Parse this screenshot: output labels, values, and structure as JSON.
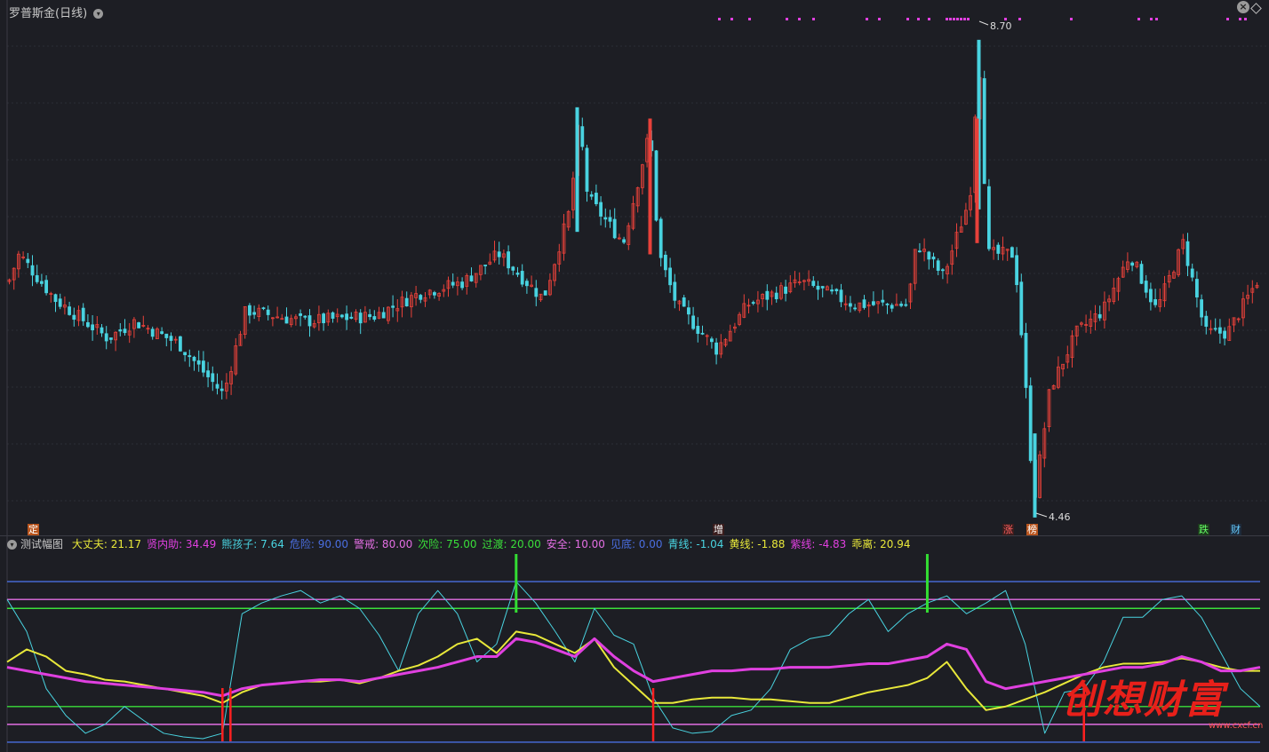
{
  "main_panel": {
    "title": "罗普斯金(日线)"
  },
  "indicator_panel": {
    "title": "测试幅图",
    "legend": [
      {
        "label": "大丈夫: 21.17",
        "color": "#e8e83a"
      },
      {
        "label": "贤内助: 34.49",
        "color": "#e040e0"
      },
      {
        "label": "熊孩子: 7.64",
        "color": "#49d3e0"
      },
      {
        "label": "危险: 90.00",
        "color": "#4a6ee0"
      },
      {
        "label": "警戒: 80.00",
        "color": "#e36fe3"
      },
      {
        "label": "次险: 75.00",
        "color": "#3ade3a"
      },
      {
        "label": "过渡: 20.00",
        "color": "#3ade3a"
      },
      {
        "label": "安全: 10.00",
        "color": "#e36fe3"
      },
      {
        "label": "见底: 0.00",
        "color": "#4a6ee0"
      },
      {
        "label": "青线: -1.04",
        "color": "#49d3e0"
      },
      {
        "label": "黄线: -1.88",
        "color": "#e8e83a"
      },
      {
        "label": "紫线: -4.83",
        "color": "#e040e0"
      },
      {
        "label": "乖离: 20.94",
        "color": "#e8e83a"
      }
    ]
  },
  "signals": [
    {
      "label": "定",
      "bg": "#b8541d",
      "color": "#ffffff"
    },
    {
      "label": "增",
      "bg": "#3a1d1d",
      "color": "#ffffff"
    },
    {
      "label": "涨",
      "bg": "#3a1d1d",
      "color": "#ff6060"
    },
    {
      "label": "榜",
      "bg": "#b8541d",
      "color": "#ffffff"
    },
    {
      "label": "跌",
      "bg": "#1d3a1d",
      "color": "#66ff66"
    },
    {
      "label": "财",
      "bg": "#1d2a3a",
      "color": "#66ccff"
    }
  ],
  "watermark": {
    "text": "创想财富",
    "url": "www.cxcf.cn"
  },
  "chart_data": [
    {
      "type": "candlestick",
      "title": "罗普斯金(日线)",
      "price_annotations": [
        {
          "label": "8.70",
          "value": 8.7
        },
        {
          "label": "4.46",
          "value": 4.46
        }
      ],
      "ylim": [
        4.4,
        8.9
      ],
      "colors": {
        "up": "#e8413a",
        "down": "#49d3e0"
      }
    },
    {
      "type": "line",
      "title": "测试幅图",
      "ylim": [
        -2,
        100
      ],
      "reference_lines": [
        {
          "name": "危险",
          "value": 90,
          "color": "#4a6ee0"
        },
        {
          "name": "警戒",
          "value": 80,
          "color": "#e36fe3"
        },
        {
          "name": "次险",
          "value": 75,
          "color": "#3ade3a"
        },
        {
          "name": "过渡",
          "value": 20,
          "color": "#3ade3a"
        },
        {
          "name": "安全",
          "value": 10,
          "color": "#e36fe3"
        },
        {
          "name": "见底",
          "value": 0,
          "color": "#4a6ee0"
        }
      ],
      "series": [
        {
          "name": "熊孩子",
          "color": "#49d3e0",
          "values": [
            80,
            62,
            30,
            15,
            5,
            10,
            20,
            12,
            5,
            3,
            2,
            5,
            72,
            78,
            82,
            85,
            78,
            82,
            75,
            60,
            40,
            72,
            85,
            72,
            45,
            55,
            90,
            78,
            62,
            45,
            75,
            60,
            55,
            25,
            8,
            5,
            6,
            15,
            18,
            30,
            52,
            58,
            60,
            72,
            80,
            62,
            72,
            78,
            82,
            72,
            78,
            85,
            55,
            5,
            28,
            30,
            45,
            70,
            70,
            80,
            82,
            70,
            50,
            30,
            20
          ]
        },
        {
          "name": "大丈夫",
          "color": "#e8e83a",
          "values": [
            45,
            52,
            48,
            40,
            38,
            35,
            34,
            32,
            30,
            28,
            26,
            22,
            28,
            32,
            33,
            34,
            34,
            35,
            33,
            36,
            40,
            43,
            48,
            55,
            58,
            50,
            62,
            60,
            55,
            50,
            58,
            42,
            32,
            22,
            22,
            24,
            25,
            25,
            24,
            24,
            23,
            22,
            22,
            25,
            28,
            30,
            32,
            36,
            45,
            30,
            18,
            20,
            24,
            28,
            33,
            38,
            42,
            44,
            44,
            45,
            47,
            45,
            42,
            40,
            40
          ]
        },
        {
          "name": "贤内助",
          "color": "#e040e0",
          "values": [
            42,
            40,
            38,
            36,
            34,
            33,
            32,
            31,
            30,
            29,
            28,
            26,
            30,
            32,
            33,
            34,
            35,
            35,
            34,
            36,
            38,
            40,
            42,
            45,
            48,
            48,
            58,
            56,
            52,
            48,
            58,
            48,
            40,
            34,
            36,
            38,
            40,
            40,
            41,
            41,
            42,
            42,
            42,
            43,
            44,
            44,
            46,
            48,
            55,
            52,
            34,
            30,
            32,
            34,
            36,
            38,
            40,
            42,
            42,
            44,
            48,
            45,
            40,
            40,
            42
          ]
        }
      ],
      "signal_bars": [
        {
          "color": "#ff2020",
          "index": 11
        },
        {
          "color": "#ff2020",
          "index": 33
        },
        {
          "color": "#ff2020",
          "index": 55
        },
        {
          "color": "#33dd33",
          "index": 26
        },
        {
          "color": "#33dd33",
          "index": 47
        }
      ]
    }
  ]
}
